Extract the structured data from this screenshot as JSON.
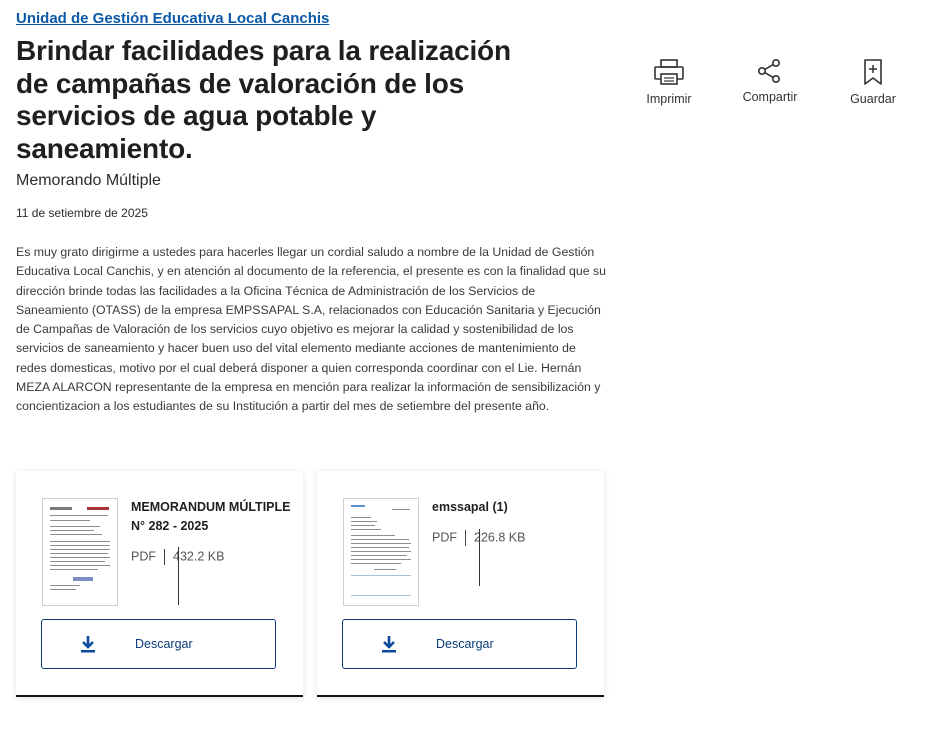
{
  "header": {
    "entity": "Unidad de Gestión Educativa Local Canchis",
    "title": "Brindar facilidades para la realización de campañas de valoración de los servicios de agua potable y saneamiento.",
    "doc_type": "Memorando Múltiple",
    "date": "11 de setiembre de 2025"
  },
  "body": "Es muy grato dirigirme a ustedes para hacerles llegar un cordial saludo a nombre de la Unidad de Gestión Educativa Local Canchis, y en atención al documento de la referencia, el presente es con la finalidad que su dirección brinde todas las facilidades a la Oficina Técnica de Administración de los Servicios de Saneamiento (OTASS) de la empresa EMPSSAPAL S.A, relacionados con Educación Sanitaria y Ejecución de Campañas de Valoración de los servicios cuyo objetivo es mejorar la calidad y sostenibilidad de los servicios de saneamiento y hacer buen uso del vital elemento mediante acciones de mantenimiento de redes domesticas, motivo por el cual deberá disponer a quien corresponda coordinar con el Lie. Hernán MEZA ALARCON representante de la empresa en mención para realizar la información de sensibilización y concientizacion a los estudiantes de su Institución a partir del mes de setiembre del presente año.",
  "actions": {
    "print": "Imprimir",
    "share": "Compartir",
    "save": "Guardar"
  },
  "icons": {
    "print": "printer-icon",
    "share": "share-icon",
    "save": "bookmark-icon",
    "download": "download-icon"
  },
  "files": [
    {
      "name": "MEMORANDUM MÚLTIPLE N° 282 - 2025",
      "format": "PDF",
      "size": "432.2 KB",
      "download_label": "Descargar"
    },
    {
      "name": "emssapal (1)",
      "format": "PDF",
      "size": "226.8 KB",
      "download_label": "Descargar"
    }
  ],
  "colors": {
    "link": "#0a58a8",
    "button_border": "#0b3a78",
    "download_icon": "#0b4a9c"
  }
}
